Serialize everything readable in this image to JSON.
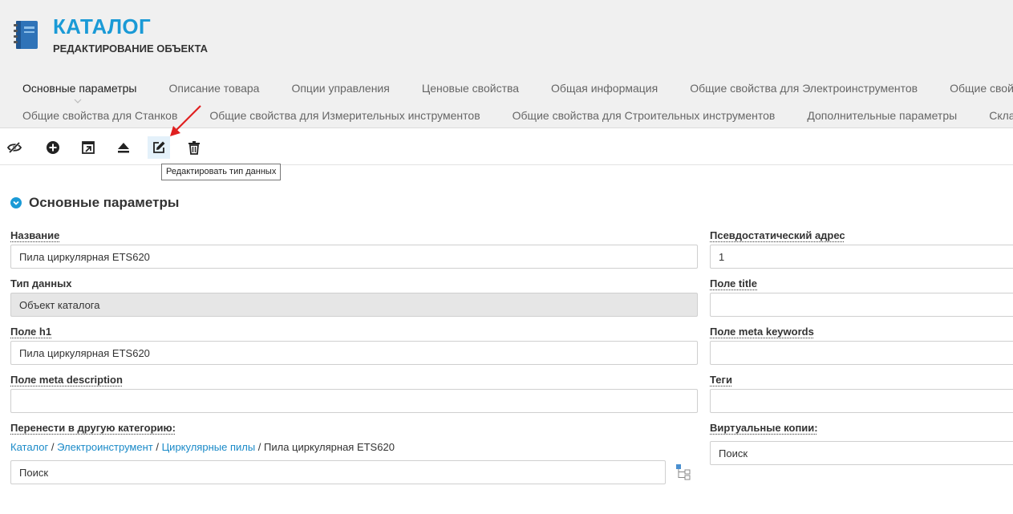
{
  "header": {
    "title": "КАТАЛОГ",
    "subtitle": "РЕДАКТИРОВАНИЕ ОБЪЕКТА",
    "icon": "book-icon"
  },
  "tabs": {
    "row1": [
      "Основные параметры",
      "Описание товара",
      "Опции управления",
      "Ценовые свойства",
      "Общая информация",
      "Общие свойства для Электроинструментов",
      "Общие свойства"
    ],
    "row2": [
      "Общие свойства для Станков",
      "Общие свойства для Измерительных инструментов",
      "Общие свойства для Строительных инструментов",
      "Дополнительные параметры",
      "Склады"
    ],
    "active": "Основные параметры"
  },
  "toolbar": {
    "buttons": [
      "hide-icon",
      "add-icon",
      "open-icon",
      "eject-icon",
      "edit-icon",
      "trash-icon"
    ],
    "tooltip": "Редактировать тип данных"
  },
  "section": {
    "title": "Основные параметры"
  },
  "form": {
    "left": {
      "name_label": "Название",
      "name_value": "Пила циркулярная ETS620",
      "type_label": "Тип данных",
      "type_value": "Объект каталога",
      "h1_label": "Поле h1",
      "h1_value": "Пила циркулярная ETS620",
      "meta_desc_label": "Поле meta description",
      "meta_desc_value": "",
      "move_label": "Перенести в другую категорию:",
      "search_placeholder": "Поиск"
    },
    "right": {
      "alias_label": "Псевдостатический адрес",
      "alias_value": "1",
      "title_label": "Поле title",
      "title_value": "",
      "keywords_label": "Поле meta keywords",
      "keywords_value": "",
      "tags_label": "Теги",
      "tags_value": "",
      "virtual_label": "Виртуальные копии:",
      "search_placeholder": "Поиск"
    }
  },
  "breadcrumb": {
    "links": [
      "Каталог",
      "Электроинструмент",
      "Циркулярные пилы"
    ],
    "separator": " / ",
    "current": "Пила циркулярная ETS620"
  },
  "colors": {
    "accent": "#1a9ad6",
    "link": "#1a8ac8",
    "arrow": "#e02020"
  }
}
